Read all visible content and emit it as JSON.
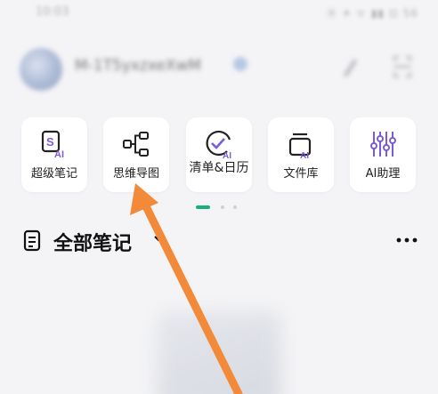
{
  "status_bar": {
    "time": "10:03",
    "icons": "⦿ ✈ ᯤ ▮▮ ⊡ 56"
  },
  "header": {
    "username": "M-1T5yxzxeXwM",
    "verified": true
  },
  "tools": [
    {
      "label": "超级笔记",
      "icon": "super-note-ai-icon"
    },
    {
      "label": "思维导图",
      "icon": "mind-map-icon"
    },
    {
      "label": "清单&日历",
      "icon": "checklist-calendar-icon"
    },
    {
      "label": "文件库",
      "icon": "file-library-ai-icon"
    },
    {
      "label": "AI助理",
      "icon": "ai-assistant-sliders-icon"
    }
  ],
  "pagination": {
    "pages": 3,
    "current": 1
  },
  "section": {
    "title": "全部笔记"
  },
  "colors": {
    "accent_green": "#1ab07a",
    "icon_purple": "#7b5cd6",
    "annotation_orange": "#f28a3a",
    "background": "#f4f4f6"
  }
}
